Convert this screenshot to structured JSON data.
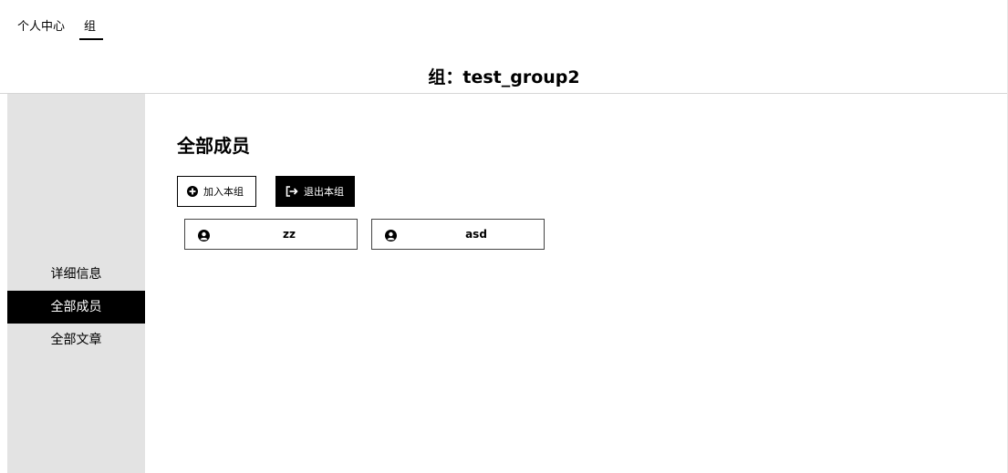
{
  "topnav": {
    "items": [
      {
        "label": "个人中心"
      },
      {
        "label": "组"
      }
    ]
  },
  "page": {
    "title": "组：test_group2"
  },
  "sidebar": {
    "items": [
      {
        "label": "详细信息",
        "active": false
      },
      {
        "label": "全部成员",
        "active": true
      },
      {
        "label": "全部文章",
        "active": false
      }
    ]
  },
  "main": {
    "section_title": "全部成员",
    "join_button": {
      "label": "加入本组",
      "icon": "plus-circle-icon"
    },
    "leave_button": {
      "label": "退出本组",
      "icon": "sign-out-icon"
    },
    "members": [
      {
        "name": "zz",
        "icon": "user-circle-icon"
      },
      {
        "name": "asd",
        "icon": "user-circle-icon"
      }
    ]
  }
}
